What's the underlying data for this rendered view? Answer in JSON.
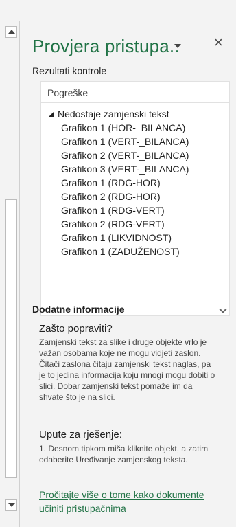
{
  "pane": {
    "title": "Provjera pristupa..",
    "close_glyph": "×",
    "results_label": "Rezultati kontrole"
  },
  "results": {
    "header": "Pogreške",
    "group": {
      "label": "Nedostaje zamjenski tekst",
      "items": [
        "Grafikon 1 (HOR-_BILANCA)",
        "Grafikon 1 (VERT-_BILANCA)",
        "Grafikon 2 (VERT-_BILANCA)",
        "Grafikon 3 (VERT-_BILANCA)",
        "Grafikon 1 (RDG-HOR)",
        "Grafikon 2 (RDG-HOR)",
        "Grafikon 1 (RDG-VERT)",
        "Grafikon 2 (RDG-VERT)",
        "Grafikon 1 (LIKVIDNOST)",
        "Grafikon 1 (ZADUŽENOST)"
      ]
    }
  },
  "additional_info": {
    "title": "Dodatne informacije",
    "why_title": "Zašto popraviti?",
    "why_text": "Zamjenski tekst za slike i druge objekte vrlo je važan osobama koje ne mogu vidjeti zaslon. Čitači zaslona čitaju zamjenski tekst naglas, pa je to jedina informacija koju mnogi mogu dobiti o slici. Dobar zamjenski tekst pomaže im da shvate što je na slici.",
    "howto_title": "Upute za rješenje:",
    "howto_text": "1. Desnom tipkom miša kliknite objekt, a zatim odaberite Uređivanje zamjenskog teksta."
  },
  "footer": {
    "learn_more": "Pročitajte više o tome kako dokumente učiniti pristupačnima"
  },
  "colors": {
    "accent": "#217346",
    "background": "#f3f3f3"
  },
  "icons": [
    "chevron-up-icon",
    "chevron-down-icon",
    "dropdown-arrow-icon",
    "close-icon",
    "expander-icon",
    "collapse-chevron-icon"
  ]
}
